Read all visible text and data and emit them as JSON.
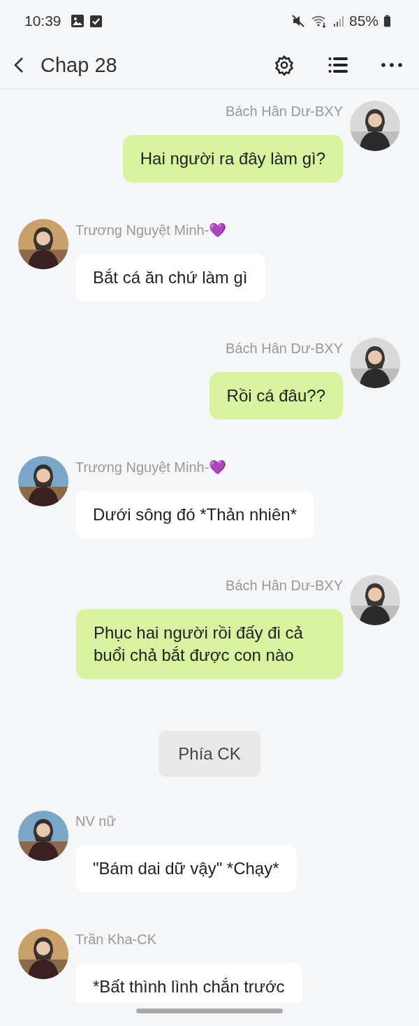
{
  "status_bar": {
    "time": "10:39",
    "battery": "85%"
  },
  "header": {
    "title": "Chap 28"
  },
  "messages": [
    {
      "kind": "right",
      "name": "Bách Hân Dư-BXY",
      "text": "Hai người ra đây làm gì?"
    },
    {
      "kind": "left",
      "name": "Trương Nguyệt Minh-💜",
      "text": "Bắt cá ăn chứ làm gì"
    },
    {
      "kind": "right",
      "name": "Bách Hân Dư-BXY",
      "text": "Rồi cá đâu??"
    },
    {
      "kind": "left",
      "name": "Trương Nguyệt Minh-💜",
      "text": "Dưới sông đó *Thản nhiên*"
    },
    {
      "kind": "right",
      "name": "Bách Hân Dư-BXY",
      "text": "Phục hai người rồi đấy đi cả buổi chả bắt được con nào"
    },
    {
      "kind": "narration",
      "text": "Phía CK"
    },
    {
      "kind": "left",
      "name": "NV nữ",
      "text": "\"Bám dai dữ vậy\" *Chạy*"
    },
    {
      "kind": "left",
      "name": "Trần Kha-CK",
      "text": "*Bất thình lình chắn trước"
    }
  ]
}
